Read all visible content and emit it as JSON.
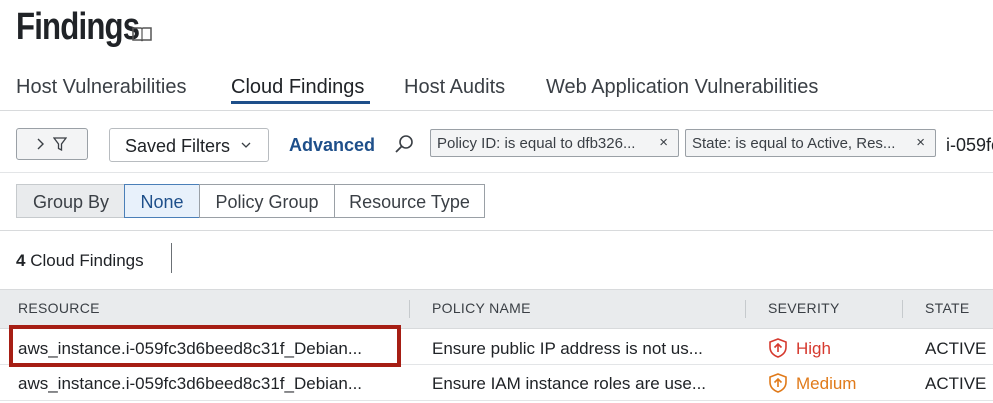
{
  "page": {
    "title": "Findings",
    "title_icon": "book-icon"
  },
  "tabs": [
    {
      "label": "Host Vulnerabilities",
      "active": false
    },
    {
      "label": "Cloud Findings",
      "active": true
    },
    {
      "label": "Host Audits",
      "active": false
    },
    {
      "label": "Web Application Vulnerabilities",
      "active": false
    }
  ],
  "filter_bar": {
    "toggle_icons": [
      "chevron-right-icon",
      "filter-icon"
    ],
    "saved_filters_label": "Saved Filters",
    "advanced_label": "Advanced",
    "chips": [
      {
        "text": "Policy ID: is equal to dfb326...",
        "remove": "×"
      },
      {
        "text": "State: is equal to Active, Res...",
        "remove": "×"
      }
    ],
    "overflow_text": "i-059fc"
  },
  "group_by": {
    "label": "Group By",
    "options": [
      {
        "label": "None",
        "active": true
      },
      {
        "label": "Policy Group",
        "active": false
      },
      {
        "label": "Resource Type",
        "active": false
      }
    ]
  },
  "results": {
    "count": "4",
    "count_label": "Cloud Findings"
  },
  "table": {
    "columns": [
      "RESOURCE",
      "POLICY NAME",
      "SEVERITY",
      "STATE"
    ],
    "rows": [
      {
        "resource": "aws_instance.i-059fc3d6beed8c31f_Debian...",
        "policy": "Ensure public IP address is not us...",
        "severity": "High",
        "state": "ACTIVE"
      },
      {
        "resource": "aws_instance.i-059fc3d6beed8c31f_Debian...",
        "policy": "Ensure IAM instance roles are use...",
        "severity": "Medium",
        "state": "ACTIVE"
      }
    ]
  },
  "colors": {
    "accent": "#1e4f8a",
    "high": "#d63a2f",
    "medium": "#e07a1a",
    "highlight": "#a61e14"
  }
}
